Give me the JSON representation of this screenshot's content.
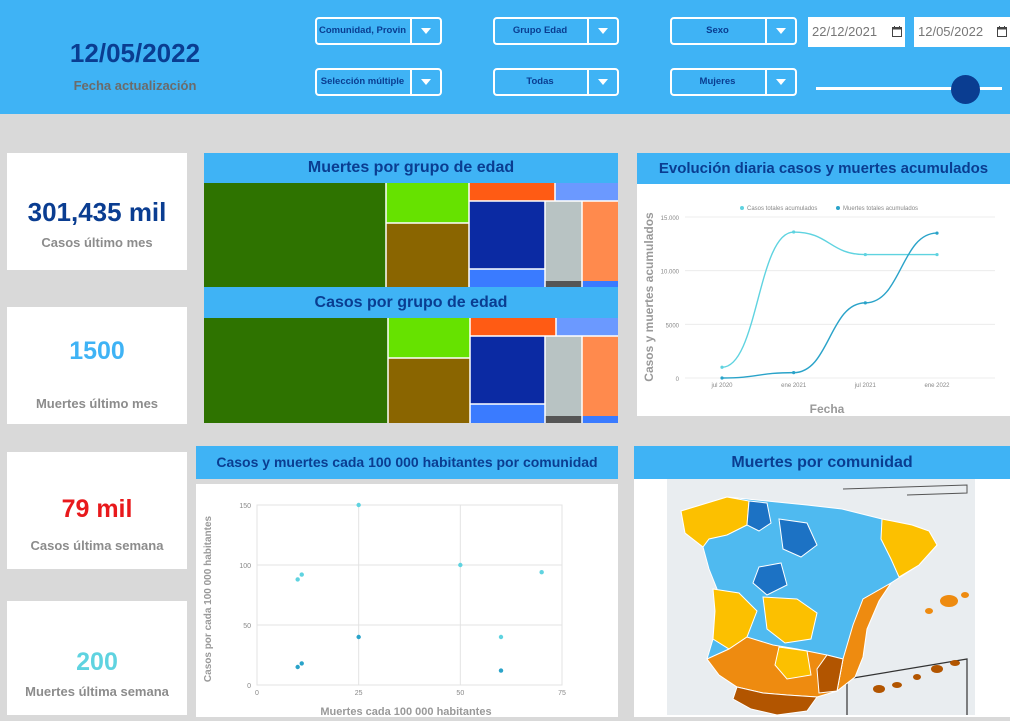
{
  "header": {
    "date_value": "12/05/2022",
    "date_label": "Fecha actualización",
    "filters": [
      {
        "label": "Comunidad, Provincia"
      },
      {
        "label": "Grupo Edad"
      },
      {
        "label": "Sexo"
      },
      {
        "label": "Selección múltiple"
      },
      {
        "label": "Todas"
      },
      {
        "label": "Mujeres"
      }
    ],
    "date_from": "22/12/2021",
    "date_to": "12/05/2022",
    "slider_level": 0.8
  },
  "kpis": [
    {
      "value": "301,435 mil",
      "label": "Casos último mes",
      "color": "#0a3d91"
    },
    {
      "value": "1500",
      "label": "Muertes último mes",
      "color": "#3fb3f5"
    },
    {
      "value": "79 mil",
      "label": "Casos última semana",
      "color": "#e8191c"
    },
    {
      "value": "200",
      "label": "Muertes última semana",
      "color": "#5fd3e0"
    }
  ],
  "treemap_deaths": {
    "title": "Muertes por grupo de edad"
  },
  "treemap_cases": {
    "title": "Casos por grupo de edad"
  },
  "line_chart": {
    "title": "Evolución diaria casos y muertes acumulados"
  },
  "scatter_chart": {
    "title": "Casos y muertes cada 100 000 habitantes por comunidad"
  },
  "map": {
    "title": "Muertes por comunidad"
  },
  "chart_data": [
    {
      "type": "line",
      "title": "Evolución diaria casos y muertes acumulados",
      "xlabel": "Fecha",
      "ylabel": "Casos y muertes acumulados",
      "x": [
        "jul 2020",
        "ene 2021",
        "jul 2021",
        "ene 2022"
      ],
      "series": [
        {
          "name": "Casos totales acumulados",
          "values": [
            1000,
            13600,
            11500,
            11500
          ],
          "color": "#5fd3e0"
        },
        {
          "name": "Muertes totales acumulados",
          "values": [
            0,
            500,
            7000,
            13500
          ],
          "color": "#2aa3c9"
        }
      ],
      "yticks": [
        "0",
        "5000",
        "10.000",
        "15.000"
      ],
      "ylim": [
        0,
        15000
      ],
      "legend": "top"
    },
    {
      "type": "scatter",
      "title": "Casos y muertes cada 100 000 habitantes por comunidad",
      "xlabel": "Muertes cada 100 000 habitantes",
      "ylabel": "Casos por cada 100 000 habitantes",
      "xlim": [
        0,
        75
      ],
      "ylim": [
        0,
        150
      ],
      "xticks": [
        "0",
        "25",
        "50",
        "75"
      ],
      "yticks": [
        "0",
        "50",
        "100",
        "150"
      ],
      "points": [
        {
          "x": 10,
          "y": 88,
          "color": "#5fd3e0"
        },
        {
          "x": 11,
          "y": 92,
          "color": "#5fd3e0"
        },
        {
          "x": 10,
          "y": 15,
          "color": "#2aa3c9"
        },
        {
          "x": 11,
          "y": 18,
          "color": "#2aa3c9"
        },
        {
          "x": 25,
          "y": 150,
          "color": "#5fd3e0"
        },
        {
          "x": 25,
          "y": 40,
          "color": "#2aa3c9"
        },
        {
          "x": 50,
          "y": 100,
          "color": "#5fd3e0"
        },
        {
          "x": 60,
          "y": 40,
          "color": "#5fd3e0"
        },
        {
          "x": 60,
          "y": 12,
          "color": "#2aa3c9"
        },
        {
          "x": 70,
          "y": 94,
          "color": "#5fd3e0"
        }
      ]
    }
  ],
  "treemap_colors": [
    "#2e7300",
    "#66e200",
    "#8a6500",
    "#ff5b14",
    "#0b2aa3",
    "#6b99ff",
    "#b8c3c3",
    "#ff8a4d",
    "#3a7bff",
    "#555555"
  ],
  "map_colors": [
    "#fcc000",
    "#4fbaf0",
    "#1c72c4",
    "#ee8b10",
    "#b25500"
  ]
}
